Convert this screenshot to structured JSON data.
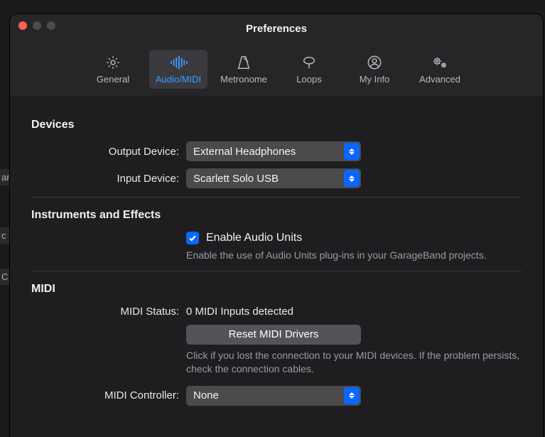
{
  "window": {
    "title": "Preferences"
  },
  "tabs": [
    {
      "id": "general",
      "label": "General"
    },
    {
      "id": "audiomidi",
      "label": "Audio/MIDI"
    },
    {
      "id": "metronome",
      "label": "Metronome"
    },
    {
      "id": "loops",
      "label": "Loops"
    },
    {
      "id": "myinfo",
      "label": "My Info"
    },
    {
      "id": "advanced",
      "label": "Advanced"
    }
  ],
  "sections": {
    "devices": {
      "title": "Devices",
      "output_label": "Output Device:",
      "output_value": "External Headphones",
      "input_label": "Input Device:",
      "input_value": "Scarlett Solo USB"
    },
    "instruments": {
      "title": "Instruments and Effects",
      "checkbox_label": "Enable Audio Units",
      "helper": "Enable the use of Audio Units plug-ins in your GarageBand projects."
    },
    "midi": {
      "title": "MIDI",
      "status_label": "MIDI Status:",
      "status_value": "0 MIDI Inputs detected",
      "reset_label": "Reset MIDI Drivers",
      "reset_helper": "Click if you lost the connection to your MIDI devices. If the problem persists, check the connection cables.",
      "controller_label": "MIDI Controller:",
      "controller_value": "None"
    }
  },
  "scraps": {
    "ar": "ar",
    "c": "c",
    "oc": "  C"
  }
}
